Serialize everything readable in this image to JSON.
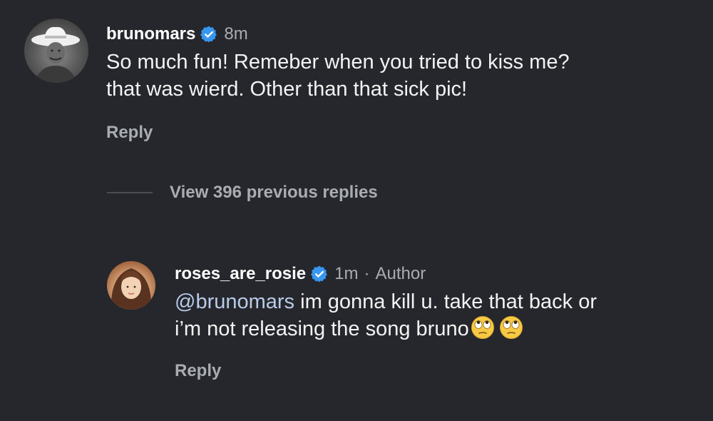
{
  "comments": [
    {
      "username": "brunomars",
      "verified": true,
      "timestamp": "8m",
      "text_line1": "So much fun! Remeber when you tried to kiss me?",
      "text_line2": "that was wierd. Other than that sick pic!",
      "reply_label": "Reply",
      "avatar_icon": "cowboy-hat-portrait-icon"
    }
  ],
  "view_replies": {
    "label": "View 396 previous replies"
  },
  "reply": {
    "username": "roses_are_rosie",
    "verified": true,
    "timestamp": "1m",
    "separator": "·",
    "author_tag": "Author",
    "mention": "@brunomars",
    "text_line1_rest": " im gonna kill u. take that back or",
    "text_line2": "i’m not releasing the song bruno",
    "emojis": [
      "eye-roll-emoji-icon",
      "eye-roll-emoji-icon"
    ],
    "reply_label": "Reply",
    "avatar_icon": "portrait-avatar-icon"
  },
  "colors": {
    "background": "#25272c",
    "verified_badge": "#3897f0",
    "secondary_text": "#a9acb2",
    "mention": "#b9cbe8"
  }
}
